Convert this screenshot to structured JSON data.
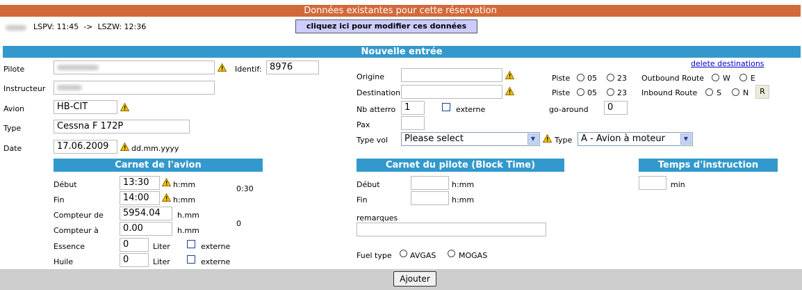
{
  "existing": {
    "header": "Données existantes pour cette réservation",
    "route": "LSPV: 11:45  ->  LSZW: 12:36",
    "modify_button": "cliquez ici pour modifier ces données"
  },
  "new_entry": {
    "header": "Nouvelle entrée",
    "delete_link": "delete destinations",
    "pilote_label": "Pilote",
    "identif_label": "Identif:",
    "identif_value": "8976",
    "instructeur_label": "Instructeur",
    "avion_label": "Avion",
    "avion_value": "HB-CIT",
    "type_label": "Type",
    "type_value": "Cessna F 172P",
    "date_label": "Date",
    "date_value": "17.06.2009",
    "date_format": "dd.mm.yyyy",
    "origine_label": "Origine",
    "destination_label": "Destination",
    "piste_label": "Piste",
    "piste_05": "05",
    "piste_23": "23",
    "outbound_label": "Outbound Route",
    "outbound_w": "W",
    "outbound_e": "E",
    "inbound_label": "Inbound Route",
    "inbound_s": "S",
    "inbound_n": "N",
    "r_button": "R",
    "nb_atterro_label": "Nb atterro",
    "nb_atterro_value": "1",
    "externe_label": "externe",
    "goaround_label": "go-around",
    "goaround_value": "0",
    "pax_label": "Pax",
    "type_vol_label": "Type vol",
    "type_vol_value": "Please select",
    "type2_label": "Type",
    "type2_value": "A - Avion à moteur"
  },
  "carnet_avion": {
    "title": "Carnet de l'avion",
    "debut_label": "Début",
    "debut_value": "13:30",
    "fin_label": "Fin",
    "fin_value": "14:00",
    "hmm": "h:mm",
    "duration": "0:30",
    "compteur_de_label": "Compteur de",
    "compteur_de_value": "5954.04",
    "compteur_a_label": "Compteur à",
    "compteur_a_value": "0.00",
    "hdotmm": "h.mm",
    "compteur_diff": "0",
    "essence_label": "Essence",
    "essence_value": "0",
    "huile_label": "Huile",
    "huile_value": "0",
    "liter": "Liter",
    "externe": "externe"
  },
  "carnet_pilote": {
    "title": "Carnet du pilote (Block Time)",
    "debut_label": "Début",
    "fin_label": "Fin",
    "hmm": "h:mm",
    "remarques_label": "remarques",
    "fuel_type_label": "Fuel type",
    "fuel_avgas": "AVGAS",
    "fuel_mogas": "MOGAS"
  },
  "instruction": {
    "title": "Temps d'instruction",
    "unit": "min"
  },
  "footer": {
    "add_button": "Ajouter"
  }
}
